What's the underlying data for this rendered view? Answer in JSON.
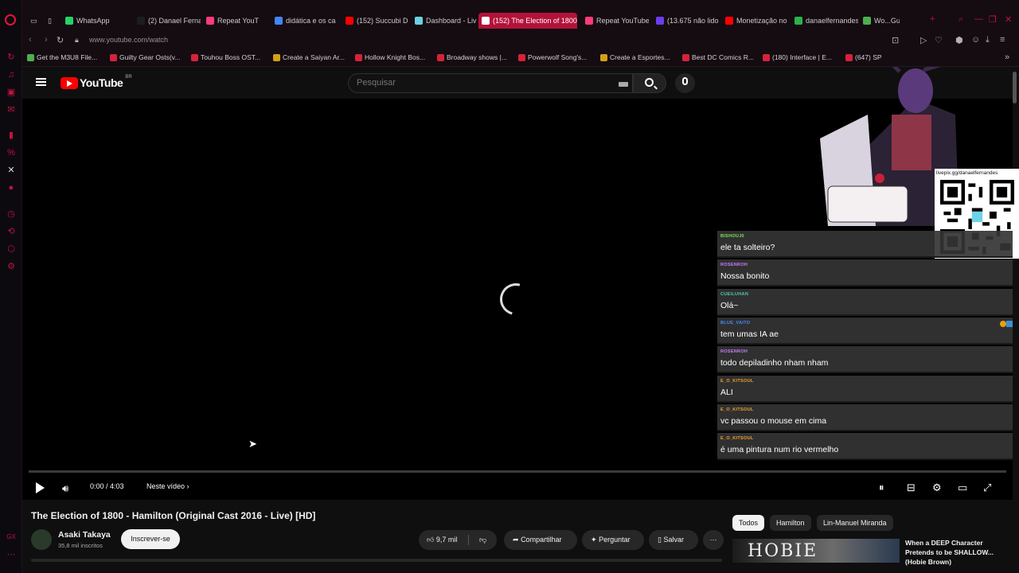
{
  "browser": {
    "tabs": [
      {
        "label": "WhatsApp",
        "color": "#25d366"
      },
      {
        "label": "(2) Danael Ferna",
        "color": "#1d1d1d"
      },
      {
        "label": "Repeat YouT",
        "color": "#ff3a7a"
      },
      {
        "label": "didática e os ca",
        "color": "#4285f4"
      },
      {
        "label": "(152) Succubi D",
        "color": "#ff0000"
      },
      {
        "label": "Dashboard - Liv",
        "color": "#6ad1e3"
      },
      {
        "label": "(152) The Election of 1800",
        "color": "#ffffff"
      },
      {
        "label": "Repeat YouTube",
        "color": "#ff3a7a"
      },
      {
        "label": "(13.675 não lido",
        "color": "#6b3df0"
      },
      {
        "label": "Monetização no",
        "color": "#ff0000"
      },
      {
        "label": "danaelfernandes",
        "color": "#2bb24c"
      },
      {
        "label": "Wo...Gue",
        "color": "#4caf50"
      }
    ],
    "new_tab": "+",
    "url": "www.youtube.com/watch",
    "bookmarks": [
      {
        "label": "Get the M3U8 File..."
      },
      {
        "label": "Guilty Gear Osts(v..."
      },
      {
        "label": "Touhou Boss OST..."
      },
      {
        "label": "Create a Saiyan Ar..."
      },
      {
        "label": "Hollow Knight Bos..."
      },
      {
        "label": "Broadway shows |..."
      },
      {
        "label": "Powerwolf Song's..."
      },
      {
        "label": "Create a Esportes..."
      },
      {
        "label": "Best DC Comics R..."
      },
      {
        "label": "(180) Interface | E..."
      },
      {
        "label": "(647) SP"
      }
    ]
  },
  "youtube": {
    "logo_text": "YouTube",
    "region": "BR",
    "search_placeholder": "Pesquisar"
  },
  "player": {
    "time": "0:00 / 4:03",
    "chapter": "Neste vídeo",
    "progress": 0
  },
  "overlay": {
    "qr_caption": "livepix.gg/danaelfernandes",
    "chat": [
      {
        "user": "BISHOUJ0",
        "text": "ele ta solteiro?",
        "color": "#7ee05a"
      },
      {
        "user": "ROSENROH",
        "text": "Nossa bonito",
        "color": "#c77dff"
      },
      {
        "user": "CUEILUHAN",
        "text": "Olá~",
        "color": "#4ec9b0"
      },
      {
        "user": "BLUE_VAITO",
        "text": "tem umas IA ae",
        "color": "#4a8cff"
      },
      {
        "user": "ROSENROH",
        "text": "todo depiladinho nham nham",
        "color": "#c77dff"
      },
      {
        "user": "E_O_KITSOUL",
        "text": "ALI",
        "color": "#f0a030"
      },
      {
        "user": "E_O_KITSOUL",
        "text": "vc passou o mouse em cima",
        "color": "#f0a030"
      },
      {
        "user": "E_O_KITSOUL",
        "text": "é uma pintura num rio vermelho",
        "color": "#f0a030"
      }
    ]
  },
  "video": {
    "title": "The Election of 1800 - Hamilton (Original Cast 2016 - Live) [HD]",
    "channel": "Asaki Takaya",
    "subscribers": "35,8 mil inscritos",
    "subscribe_label": "Inscrever-se",
    "likes": "9,7 mil",
    "share_label": "Compartilhar",
    "ask_label": "Perguntar",
    "save_label": "Salvar",
    "more_label": "···"
  },
  "sidebar_right": {
    "chips": [
      "Todos",
      "Hamilton",
      "Lin-Manuel Miranda"
    ],
    "rec_thumb_text": "HOBIE",
    "rec_title": "When a DEEP Character Pretends to be SHALLOW... (Hobie Brown)"
  },
  "accent": "#ff0000",
  "gx_accent": "#c2123f"
}
